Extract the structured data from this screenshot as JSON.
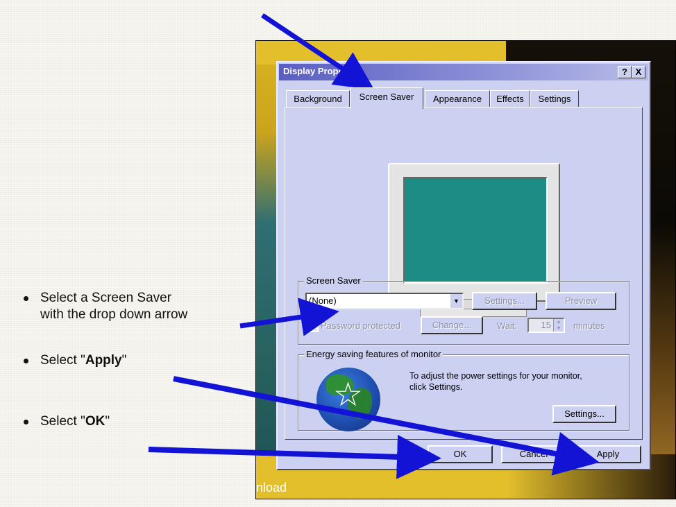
{
  "instructions": [
    {
      "line1": "Select a Screen Saver",
      "line2": "with the drop down arrow"
    },
    {
      "prefix": "Select \"",
      "bold": "Apply",
      "suffix": "\""
    },
    {
      "prefix": "Select \"",
      "bold": "OK",
      "suffix": "\""
    }
  ],
  "desktop": {
    "partial_text": "nload"
  },
  "dialog": {
    "title": "Display Properties",
    "help_label": "?",
    "close_label": "X",
    "tabs": [
      "Background",
      "Screen Saver",
      "Appearance",
      "Effects",
      "Settings"
    ],
    "active_tab": "Screen Saver",
    "screen_saver_group": {
      "label": "Screen Saver",
      "selected": "(None)",
      "settings_label": "Settings...",
      "preview_label": "Preview",
      "password_label": "Password protected",
      "change_label": "Change...",
      "wait_label": "Wait:",
      "wait_value": "15",
      "minutes_label": "minutes"
    },
    "energy_group": {
      "label": "Energy saving features of monitor",
      "text_line1": "To adjust the power settings for your monitor,",
      "text_line2": "click Settings.",
      "settings_label": "Settings...",
      "logo_icon": "energy-star-globe-icon"
    },
    "ok_label": "OK",
    "cancel_label": "Cancel",
    "apply_label": "Apply"
  },
  "colors": {
    "dialog_bg": "#cdd1f1",
    "titlebar": "#5a5ec2",
    "monitor_screen": "#1c8c84",
    "arrow": "#1313d6"
  }
}
